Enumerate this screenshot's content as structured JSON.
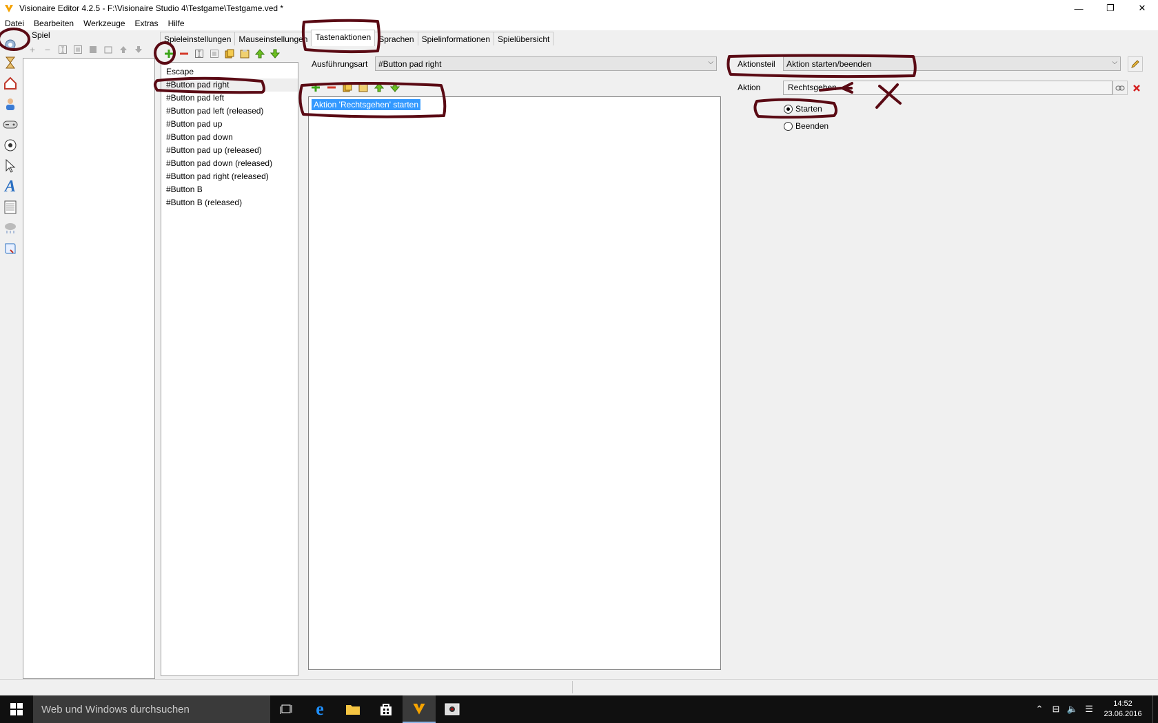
{
  "window": {
    "title": "Visionaire Editor 4.2.5 - F:\\Visionaire Studio 4\\Testgame\\Testgame.ved *",
    "minimize": "—",
    "restore": "❐",
    "close": "✕"
  },
  "menu": [
    "Datei",
    "Bearbeiten",
    "Werkzeuge",
    "Extras",
    "Hilfe"
  ],
  "left_panel": {
    "title": "Spiel"
  },
  "tabs": [
    "Spieleinstellungen",
    "Mauseinstellungen",
    "Tastenaktionen",
    "Sprachen",
    "Spielinformationen",
    "Spielübersicht"
  ],
  "active_tab": "Tastenaktionen",
  "key_list": [
    "Escape",
    "#Button pad right",
    "#Button pad left",
    "#Button pad left (released)",
    "#Button pad up",
    "#Button pad down",
    "#Button pad up (released)",
    "#Button pad down (released)",
    "#Button pad right (released)",
    "#Button B",
    "#Button B (released)"
  ],
  "selected_key": "#Button pad right",
  "execution": {
    "label": "Ausführungsart",
    "value": "#Button pad right"
  },
  "action_list": [
    "Aktion 'Rechtsgehen' starten"
  ],
  "action_part": {
    "label": "Aktionsteil",
    "value": "Aktion starten/beenden"
  },
  "action": {
    "label": "Aktion",
    "value": "Rechtsgehen"
  },
  "radio": {
    "start": "Starten",
    "end": "Beenden",
    "selected": "Starten"
  },
  "taskbar": {
    "search_placeholder": "Web und Windows durchsuchen",
    "time": "14:52",
    "date": "23.06.2016"
  },
  "colors": {
    "selection": "#3399ff",
    "annotation": "#5a0a14",
    "taskbar": "#101010"
  }
}
